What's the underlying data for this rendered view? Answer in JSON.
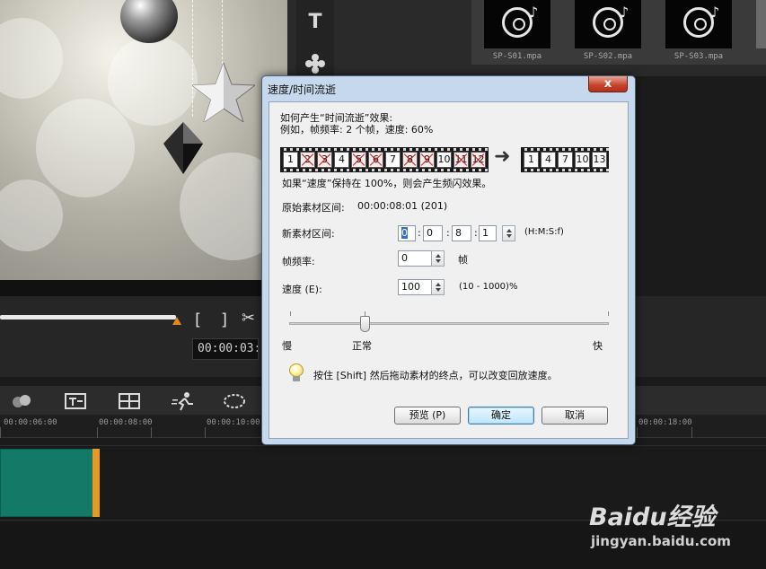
{
  "library": {
    "thumbs": [
      {
        "label": "SP-S01.mpa",
        "icon": "music-disc-icon"
      },
      {
        "label": "SP-S02.mpa",
        "icon": "music-disc-icon"
      },
      {
        "label": "SP-S03.mpa",
        "icon": "music-disc-icon"
      }
    ],
    "title_tool_glyph": "T"
  },
  "player": {
    "timecode": "00:00:03:",
    "bracket_in": "[",
    "bracket_out": "]",
    "scissors_glyph": "✂"
  },
  "timeline": {
    "ticks": [
      "00:00:06:00",
      "00:00:08:00",
      "00:00:10:00",
      "00:00:18:00"
    ]
  },
  "dialog": {
    "title": "速度/时间流逝",
    "close_glyph": "x",
    "intro_line1": "如何产生“时间流逝”效果:",
    "intro_line2": "例如，帧频率: 2 个帧，速度: 60%",
    "source_frames": [
      "1",
      "2",
      "3",
      "4",
      "5",
      "6",
      "7",
      "8",
      "9",
      "10",
      "11",
      "12"
    ],
    "result_frames": [
      "1",
      "4",
      "7",
      "10",
      "13"
    ],
    "arrow_glyph": "➜",
    "flicker_note": "如果“速度”保持在 100%，则会产生频闪效果。",
    "original_duration_label": "原始素材区间:",
    "original_duration_value": "00:00:08:01 (201)",
    "new_duration_label": "新素材区间:",
    "new_duration": {
      "h": "0",
      "m": "0",
      "s": "8",
      "f": "1"
    },
    "new_duration_format": "(H:M:S:f)",
    "frame_rate_label": "帧频率:",
    "frame_rate_value": "0",
    "frame_rate_unit": "帧",
    "speed_label": "速度 (E):",
    "speed_value": "100",
    "speed_range": "(10 - 1000)%",
    "slider_slow": "慢",
    "slider_normal": "正常",
    "slider_fast": "快",
    "slider_level_percent": 100,
    "tip": "按住 [Shift] 然后拖动素材的终点，可以改变回放速度。",
    "buttons": {
      "preview": "预览 (P)",
      "ok": "确定",
      "cancel": "取消"
    }
  },
  "watermark": {
    "logo": "Baidu经验",
    "url": "jingyan.baidu.com"
  }
}
